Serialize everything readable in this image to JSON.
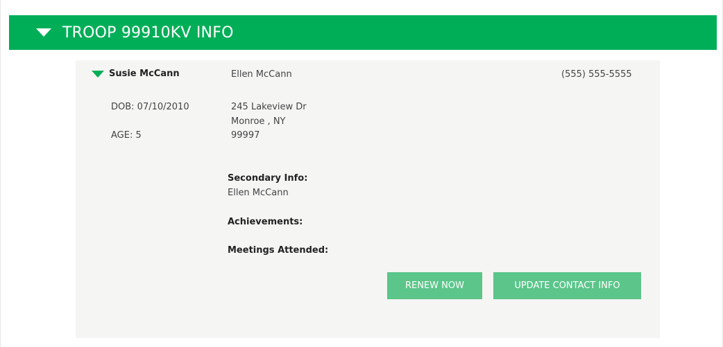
{
  "header": {
    "title": "TROOP 99910KV INFO"
  },
  "member": {
    "name": "Susie McCann",
    "dob": "DOB: 07/10/2010",
    "age": "AGE: 5",
    "guardian": "Ellen McCann",
    "phone": "(555) 555-5555",
    "address": {
      "street": "245 Lakeview Dr",
      "city_state": "Monroe , NY",
      "zip": "99997"
    },
    "secondary_label": "Secondary Info:",
    "secondary_value": "Ellen McCann",
    "achievements_label": "Achievements:",
    "meetings_label": "Meetings Attended:"
  },
  "actions": {
    "renew_label": "RENEW NOW",
    "update_label": "UPDATE CONTACT INFO"
  },
  "colors": {
    "header_green": "#00ae58",
    "button_green": "#5bc58a",
    "card_bg": "#f5f5f4"
  },
  "icons": {
    "header_toggle": "caret-down-icon",
    "member_toggle": "caret-down-icon"
  }
}
